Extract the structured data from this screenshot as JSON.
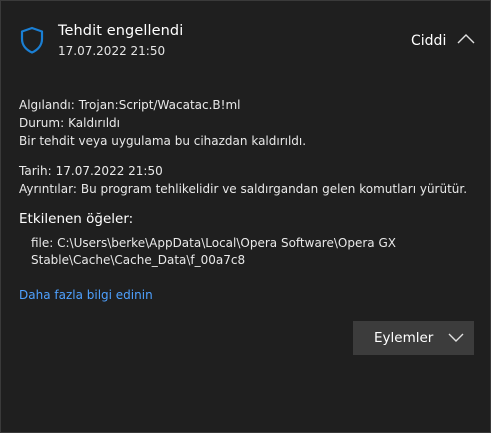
{
  "notification": {
    "title": "Tehdit engellendi",
    "timestamp": "17.07.2022 21:50",
    "severity": "Ciddi",
    "icons": {
      "shield": "shield-icon",
      "collapse": "chevron-up-icon",
      "actions": "chevron-down-icon"
    },
    "colors": {
      "accent": "#1a7fd4",
      "link": "#4ea1ff",
      "background": "#1f1f1f",
      "button": "#3c3c3c"
    }
  },
  "details": {
    "detected_label": "Algılandı:",
    "detected_value": "Trojan:Script/Wacatac.B!ml",
    "status_label": "Durum:",
    "status_value": "Kaldırıldı",
    "description": "Bir tehdit veya uygulama bu cihazdan kaldırıldı.",
    "date_label": "Tarih:",
    "date_value": "17.07.2022 21:50",
    "details_label": "Ayrıntılar:",
    "details_value": "Bu program tehlikelidir ve saldırgandan gelen komutları yürütür."
  },
  "affected": {
    "title": "Etkilenen öğeler:",
    "path": "file: C:\\Users\\berke\\AppData\\Local\\Opera Software\\Opera GX Stable\\Cache\\Cache_Data\\f_00a7c8"
  },
  "learn_more": "Daha fazla bilgi edinin",
  "actions_label": "Eylemler"
}
